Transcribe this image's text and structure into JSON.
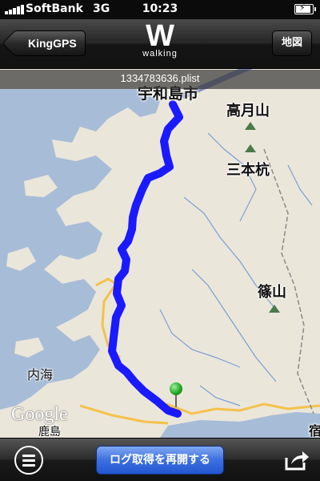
{
  "status_bar": {
    "carrier": "SoftBank",
    "network": "3G",
    "time": "10:23",
    "battery_icon": "charging-battery-icon"
  },
  "nav_bar": {
    "back_label": "KingGPS",
    "logo_letter": "W",
    "logo_subtitle": "walking",
    "map_button_label": "地図"
  },
  "file": {
    "name": "1334783636.plist"
  },
  "map": {
    "labels": {
      "uwajima": "宇和島市",
      "takatsukiyama": "高月山",
      "sanbonkui": "三本杭",
      "sasayama": "篠山",
      "uchiumi": "内海",
      "kashima": "鹿島",
      "edge": "宿"
    },
    "google_logo": "Google",
    "track_color": "#1a1aff",
    "pin_color": "#22aa22"
  },
  "toolbar": {
    "menu_icon": "menu-icon",
    "resume_label": "ログ取得を再開する",
    "share_icon": "share-icon"
  }
}
